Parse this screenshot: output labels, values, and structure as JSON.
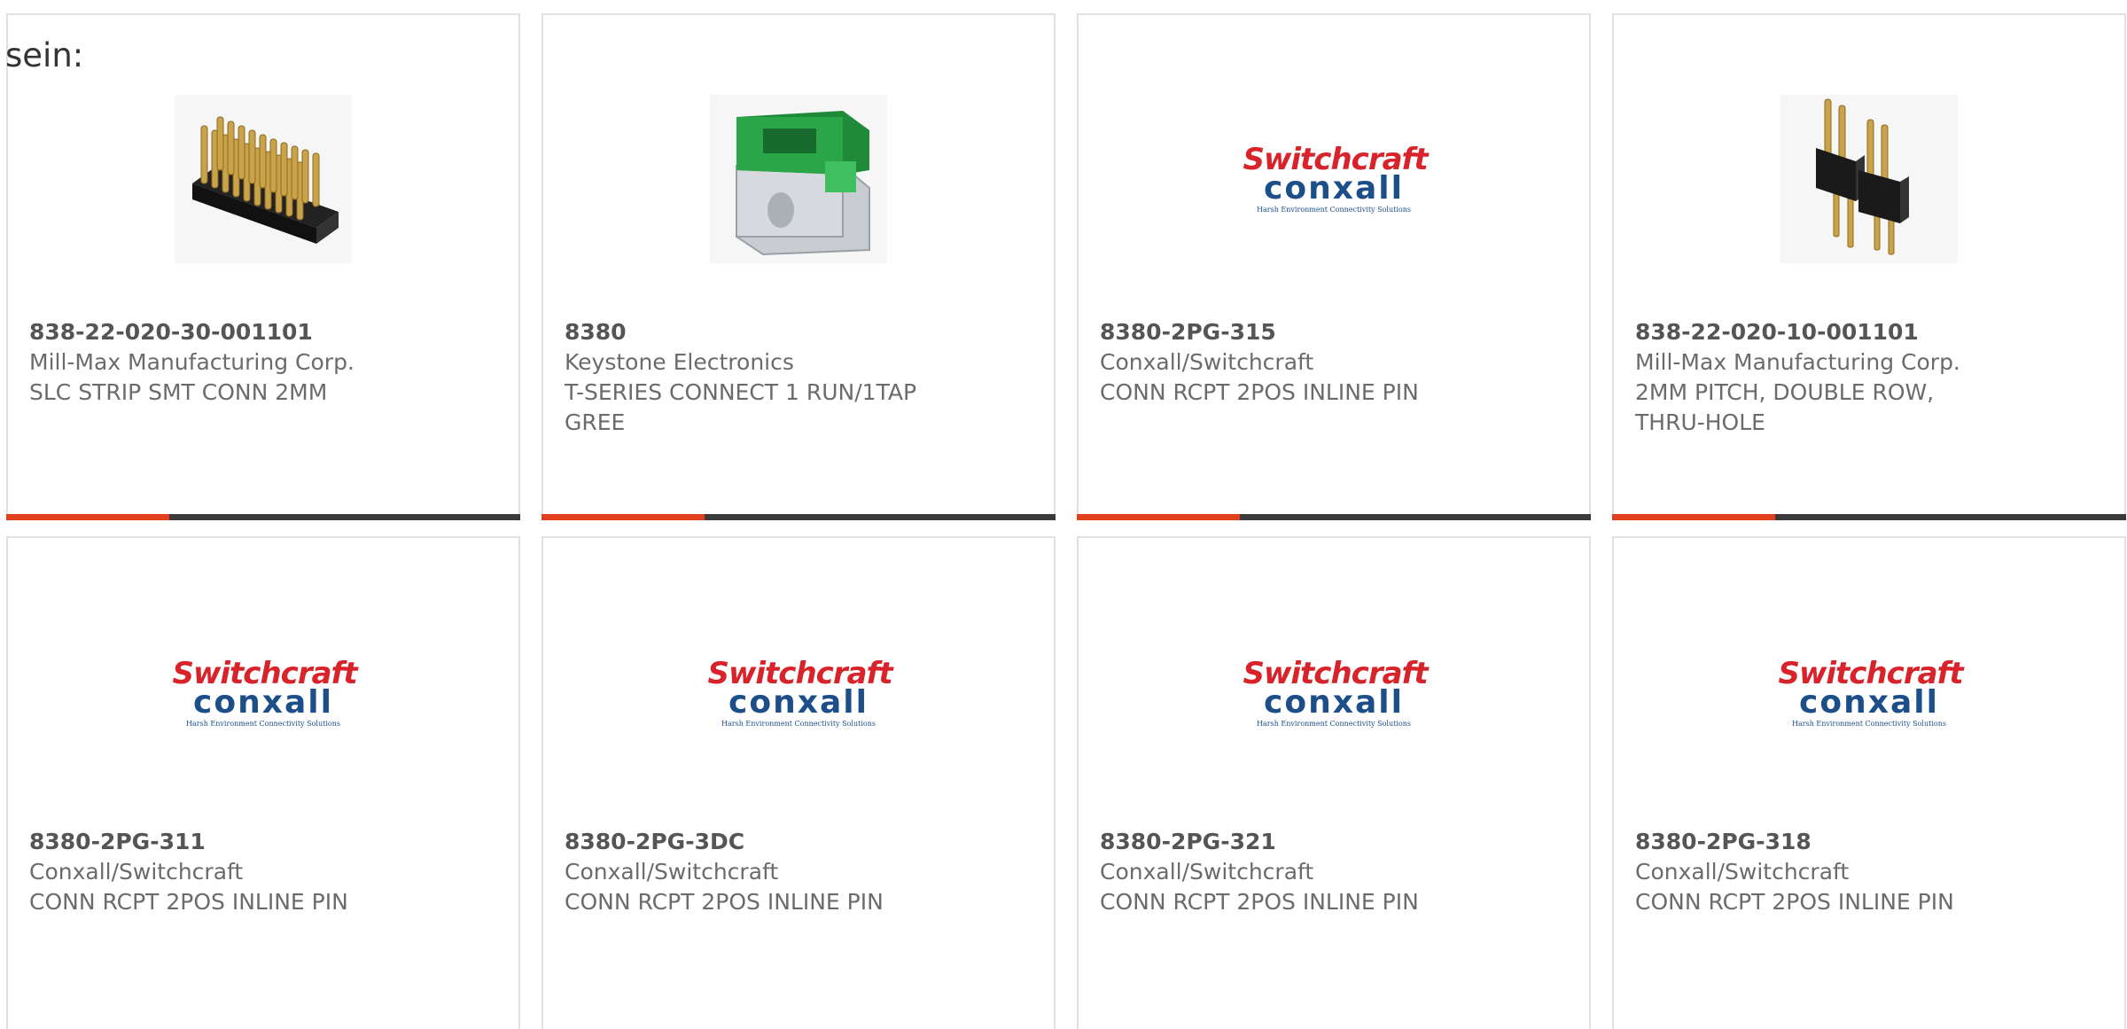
{
  "lead_text": "sein:",
  "logo": {
    "line1": "Switchcraft",
    "line2": "conxall",
    "line3": "Harsh Environment Connectivity Solutions"
  },
  "colors": {
    "accent": "#e2401c",
    "bar": "#3a3a3a",
    "logo_red": "#d8232a",
    "logo_blue": "#1c4f8a"
  },
  "products": [
    {
      "part": "838-22-020-30-001101",
      "manufacturer": "Mill-Max Manufacturing Corp.",
      "description": "SLC STRIP SMT CONN 2MM",
      "image": "pin-strip-smt-image"
    },
    {
      "part": "8380",
      "manufacturer": "Keystone Electronics",
      "description": "T-SERIES CONNECT 1 RUN/1TAP GREE",
      "image": "green-connector-image"
    },
    {
      "part": "8380-2PG-315",
      "manufacturer": "Conxall/Switchcraft",
      "description": "CONN RCPT 2POS INLINE PIN",
      "image": "switchcraft-conxall-logo"
    },
    {
      "part": "838-22-020-10-001101",
      "manufacturer": "Mill-Max Manufacturing Corp.",
      "description": "2MM PITCH, DOUBLE ROW, THRU-HOLE",
      "image": "pin-header-thru-hole-image"
    },
    {
      "part": "8380-2PG-311",
      "manufacturer": "Conxall/Switchcraft",
      "description": "CONN RCPT 2POS INLINE PIN",
      "image": "switchcraft-conxall-logo"
    },
    {
      "part": "8380-2PG-3DC",
      "manufacturer": "Conxall/Switchcraft",
      "description": "CONN RCPT 2POS INLINE PIN",
      "image": "switchcraft-conxall-logo"
    },
    {
      "part": "8380-2PG-321",
      "manufacturer": "Conxall/Switchcraft",
      "description": "CONN RCPT 2POS INLINE PIN",
      "image": "switchcraft-conxall-logo"
    },
    {
      "part": "8380-2PG-318",
      "manufacturer": "Conxall/Switchcraft",
      "description": "CONN RCPT 2POS INLINE PIN",
      "image": "switchcraft-conxall-logo"
    }
  ]
}
